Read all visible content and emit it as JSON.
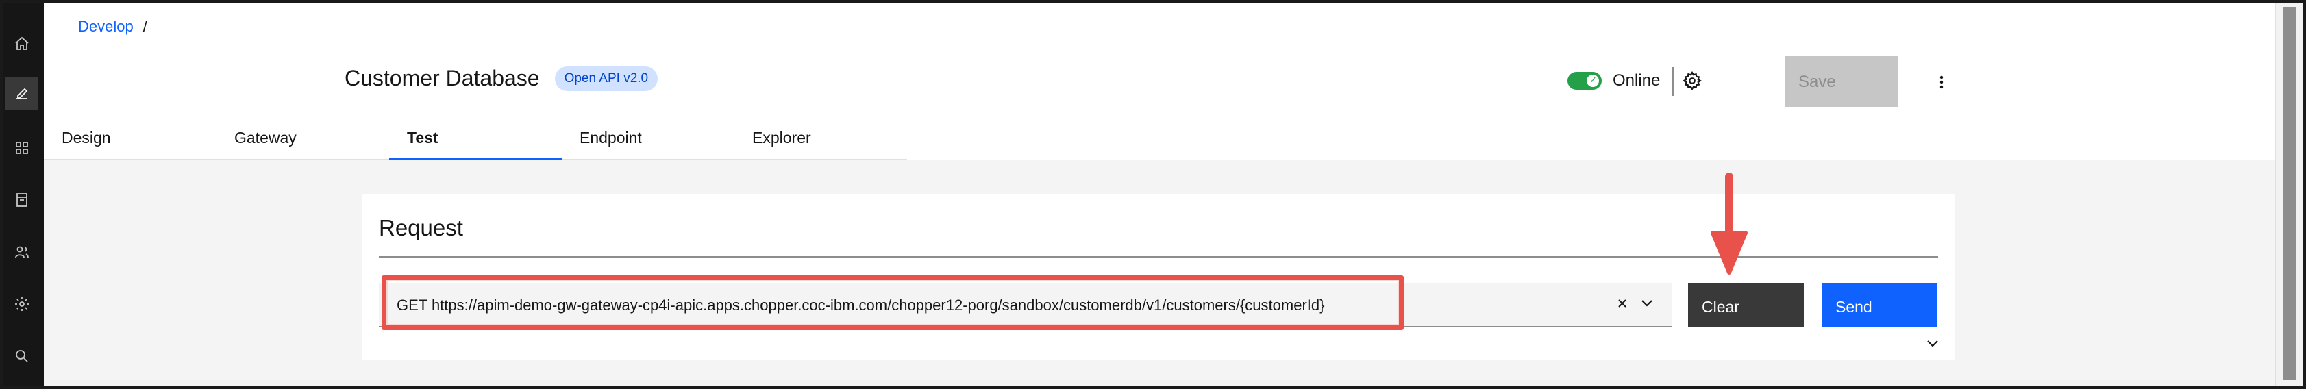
{
  "breadcrumb": {
    "root": "Develop",
    "separator": "/"
  },
  "header": {
    "title": "Customer Database",
    "badge": "Open API v2.0",
    "status_label": "Online",
    "save_label": "Save"
  },
  "tabs": [
    {
      "label": "Design",
      "active": false
    },
    {
      "label": "Gateway",
      "active": false
    },
    {
      "label": "Test",
      "active": true
    },
    {
      "label": "Endpoint",
      "active": false
    },
    {
      "label": "Explorer",
      "active": false
    }
  ],
  "request": {
    "title": "Request",
    "url_value": "GET https://apim-demo-gw-gateway-cp4i-apic.apps.chopper.coc-ibm.com/chopper12-porg/sandbox/customerdb/v1/customers/{customerId}",
    "clear_label": "Clear",
    "send_label": "Send"
  },
  "icons": {
    "rail": [
      "home-icon",
      "edit-icon",
      "apps-icon",
      "catalog-icon",
      "users-icon",
      "settings-icon",
      "search-icon"
    ],
    "header": [
      "gear-icon",
      "overflow-menu-icon"
    ],
    "field": [
      "close-icon",
      "chevron-down-icon"
    ]
  },
  "colors": {
    "primary": "#0f62fe",
    "toggle_on": "#24a148",
    "annotation": "#e8524a",
    "rail_bg": "#161616"
  }
}
